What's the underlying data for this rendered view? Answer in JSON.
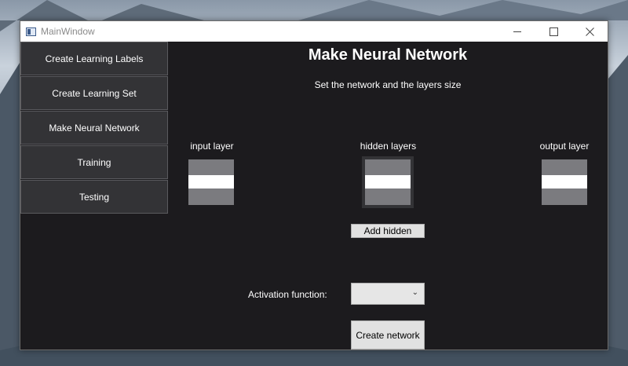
{
  "window": {
    "title": "MainWindow"
  },
  "sidebar": {
    "items": [
      {
        "label": "Create Learning Labels"
      },
      {
        "label": "Create Learning Set"
      },
      {
        "label": "Make Neural Network"
      },
      {
        "label": "Training"
      },
      {
        "label": "Testing"
      }
    ]
  },
  "main": {
    "title": "Make Neural Network",
    "subtitle": "Set the network and the layers size",
    "layers": {
      "input_label": "input layer",
      "hidden_label": "hidden layers",
      "output_label": "output layer",
      "input_value": "",
      "hidden_value": "",
      "output_value": ""
    },
    "add_hidden_label": "Add hidden",
    "activation_label": "Activation function:",
    "activation_value": "",
    "create_network_label": "Create network"
  },
  "icons": {
    "app": "window-app-icon",
    "minimize": "minimize-icon",
    "maximize": "maximize-icon",
    "close": "close-icon",
    "dropdown": "chevron-down-icon"
  },
  "colors": {
    "background": "#1c1b1e",
    "nav_button": "#333336",
    "layer_box": "#7b7b7f",
    "light_button": "#e1e1e1"
  }
}
